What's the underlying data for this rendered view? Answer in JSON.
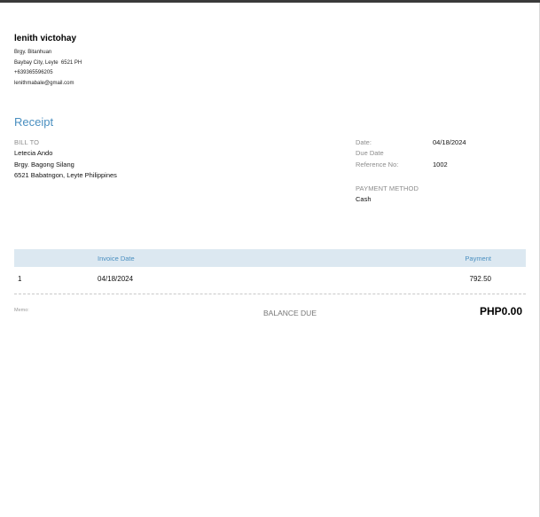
{
  "sender": {
    "name": "lenith victohay",
    "lines": [
      "Brgy. Bitanhuan",
      "Baybay City, Leyte  6521 PH",
      "+639365596205",
      "lenithmabale@gmail.com"
    ]
  },
  "title": "Receipt",
  "bill_to": {
    "label": "BILL TO",
    "lines": [
      "Letecia Ando",
      "Brgy. Bagong Silang",
      "6521 Babatngon, Leyte Philippines"
    ]
  },
  "meta": {
    "date_label": "Date:",
    "date_value": "04/18/2024",
    "due_label": "Due Date",
    "due_value": "",
    "ref_label": "Reference No:",
    "ref_value": "1002"
  },
  "payment": {
    "label": "PAYMENT METHOD",
    "value": "Cash"
  },
  "table": {
    "headers": {
      "invoice_date": "Invoice Date",
      "payment": "Payment"
    },
    "rows": [
      {
        "num": "1",
        "date": "04/18/2024",
        "payment": "792.50"
      }
    ]
  },
  "footer": {
    "memo_label": "Memo:",
    "balance_label": "BALANCE DUE",
    "balance_value": "PHP0.00"
  }
}
